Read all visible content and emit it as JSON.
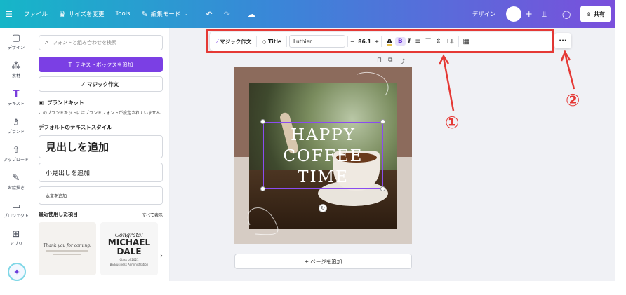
{
  "topbar": {
    "menu_icon": "hamburger-icon",
    "file": "ファイル",
    "resize": "サイズを変更",
    "tools": "Tools",
    "edit_mode": "編集モード",
    "undo_icon": "undo-icon",
    "redo_icon": "redo-icon",
    "cloud_icon": "cloud-sync-icon",
    "design_label": "デザイン",
    "share": "共有",
    "colors": {
      "gradient_start": "#16b6c8",
      "gradient_end": "#7a4fdc"
    }
  },
  "rail": {
    "items": [
      {
        "label": "デザイン",
        "icon": "layout-icon"
      },
      {
        "label": "素材",
        "icon": "elements-icon"
      },
      {
        "label": "テキスト",
        "icon": "text-icon"
      },
      {
        "label": "ブランド",
        "icon": "brand-icon"
      },
      {
        "label": "アップロード",
        "icon": "upload-icon"
      },
      {
        "label": "お絵描き",
        "icon": "draw-icon"
      },
      {
        "label": "プロジェクト",
        "icon": "folder-icon"
      },
      {
        "label": "アプリ",
        "icon": "apps-icon"
      }
    ],
    "active": "テキスト",
    "accent": "#7a3ddc"
  },
  "panel": {
    "search_placeholder": "フォントと組み合わせを検索",
    "add_textbox": "テキストボックスを追加",
    "magic_write": "マジック作文",
    "brand_kit_title": "ブランドキット",
    "brand_kit_desc": "このブランドキットにはブランドフォントが設定されていません",
    "default_styles_title": "デフォルトのテキストスタイル",
    "heading": "見出しを追加",
    "subheading": "小見出しを追加",
    "body": "本文を追加",
    "recent_title": "最近使用した項目",
    "see_all": "すべて表示",
    "thumb1_script": "Thank you for coming!",
    "thumb2_congrats": "Congrats!",
    "thumb2_name_line1": "MICHAEL",
    "thumb2_name_line2": "DALE",
    "thumb2_small1": "Class of 2021",
    "thumb2_small2": "BS Business Administration"
  },
  "toolbar": {
    "magic_write": "マジック作文",
    "title": "Title",
    "font": "Luthier",
    "size": "86.1",
    "minus": "−",
    "plus": "+",
    "text_color": "A",
    "bold": "B",
    "italic": "I",
    "more": "···",
    "highlight_color": "#e53935"
  },
  "annotations": {
    "one": "①",
    "two": "②"
  },
  "design": {
    "title_line1": "HAPPY",
    "title_line2": "COFFEE",
    "title_line3": "TIME",
    "bg_top": "#8c6b5c",
    "bg_bottom": "#d6ccc4"
  },
  "add_page": "+ ページを追加"
}
